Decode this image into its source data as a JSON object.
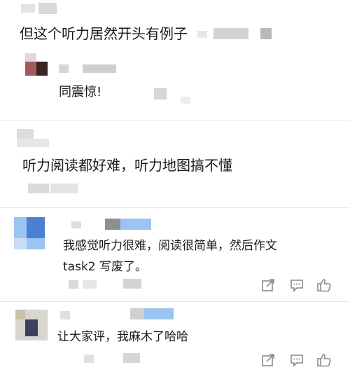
{
  "comments": [
    {
      "text": "但这个听力居然开头有例子"
    },
    {
      "reply": {
        "text": "同震惊!"
      }
    },
    {
      "text": "听力阅读都好难，听力地图搞不懂"
    },
    {
      "text_line1": "我感觉听力很难，阅读很简单，然后作文",
      "text_line2": "task2 写废了。",
      "actions": {
        "share_icon": "share-icon",
        "comment_icon": "comment-icon",
        "like_icon": "thumbs-up-icon"
      }
    },
    {
      "text": "让大家评，我麻木了哈哈",
      "actions": {
        "share_icon": "share-icon",
        "comment_icon": "comment-icon",
        "like_icon": "thumbs-up-icon"
      }
    }
  ],
  "colors": {
    "text": "#1a1a1a",
    "icon": "#8a8a8a",
    "divider": "#e6e6e6",
    "blur_gray": "#d6d6d6",
    "blur_blue": "#4a7fd4",
    "blur_light_blue": "#9cc4f2"
  }
}
